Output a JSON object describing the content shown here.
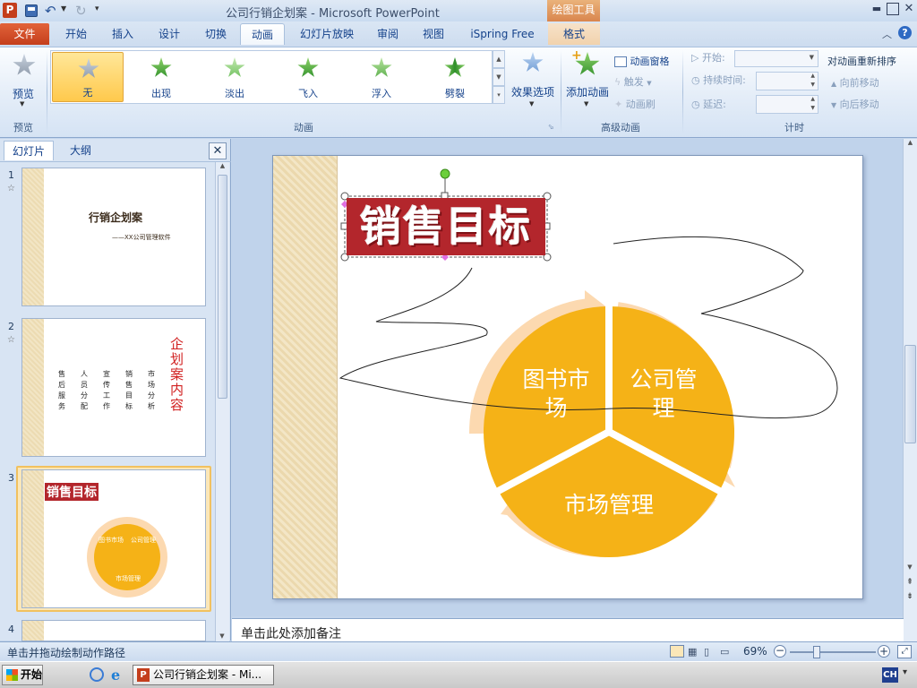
{
  "title_bar": {
    "title": "公司行销企划案 - Microsoft PowerPoint",
    "contextual_tab_group": "绘图工具"
  },
  "tabs": [
    {
      "label": "文件"
    },
    {
      "label": "开始"
    },
    {
      "label": "插入"
    },
    {
      "label": "设计"
    },
    {
      "label": "切换"
    },
    {
      "label": "动画"
    },
    {
      "label": "幻灯片放映"
    },
    {
      "label": "审阅"
    },
    {
      "label": "视图"
    },
    {
      "label": "iSpring Free"
    },
    {
      "label": "格式"
    }
  ],
  "active_tab": "动画",
  "ribbon": {
    "preview": {
      "button": "预览",
      "group": "预览"
    },
    "animation_gallery": {
      "items": [
        "无",
        "出现",
        "淡出",
        "飞入",
        "浮入",
        "劈裂"
      ],
      "selected": "无",
      "group": "动画"
    },
    "effect_options": "效果选项",
    "advanced": {
      "add_animation": "添加动画",
      "animation_pane": "动画窗格",
      "trigger": "触发",
      "painter": "动画刷",
      "group": "高级动画"
    },
    "timing": {
      "start_label": "开始:",
      "duration_label": "持续时间:",
      "delay_label": "延迟:",
      "group": "计时"
    },
    "reorder": {
      "title": "对动画重新排序",
      "move_earlier": "向前移动",
      "move_later": "向后移动"
    }
  },
  "panel": {
    "tabs": [
      "幻灯片",
      "大纲"
    ],
    "slides": [
      {
        "number": "1",
        "title": "行销企划案",
        "subtitle": "——XX公司管理软件"
      },
      {
        "number": "2",
        "vertical_title": "企划案内容",
        "columns": [
          "售后服务",
          "人员分配",
          "宣传工作",
          "销售目标",
          "市场分析"
        ]
      },
      {
        "number": "3",
        "title": "销售目标",
        "pie": [
          "图书市场",
          "公司管理",
          "市场管理"
        ]
      },
      {
        "number": "4"
      }
    ]
  },
  "slide": {
    "title": "销售目标",
    "segments": {
      "top_left": "图书市场",
      "top_right": "公司管理",
      "bottom": "市场管理"
    }
  },
  "notes_placeholder": "单击此处添加备注",
  "status": {
    "hint": "单击并拖动绘制动作路径",
    "zoom": "69%"
  },
  "taskbar": {
    "start": "开始",
    "window": "公司行销企划案 - Mi...",
    "lang": "CH"
  },
  "colors": {
    "accent_orange": "#f5b217",
    "ring": "#fcd9b0",
    "title_red": "#b3262c",
    "file_tab": "#d74b16"
  }
}
